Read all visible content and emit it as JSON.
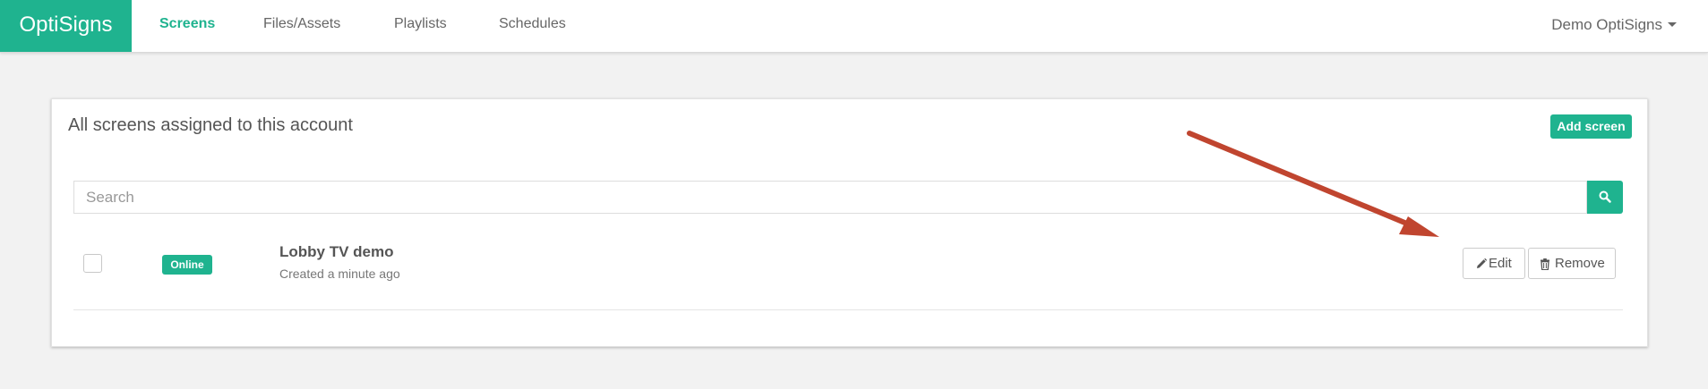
{
  "header": {
    "brand": "OptiSigns",
    "nav": [
      {
        "label": "Screens",
        "active": true
      },
      {
        "label": "Files/Assets",
        "active": false
      },
      {
        "label": "Playlists",
        "active": false
      },
      {
        "label": "Schedules",
        "active": false
      }
    ],
    "account_label": "Demo OptiSigns"
  },
  "panel": {
    "title": "All screens assigned to this account",
    "add_button": "Add screen",
    "search": {
      "placeholder": "Search",
      "value": ""
    }
  },
  "screens": [
    {
      "status": "Online",
      "name": "Lobby TV demo",
      "subtitle": "Created a minute ago",
      "edit_label": "Edit",
      "remove_label": "Remove"
    }
  ],
  "colors": {
    "accent": "#1fb38f",
    "annotation_arrow": "#c0452f",
    "background": "#f2f2f2"
  }
}
